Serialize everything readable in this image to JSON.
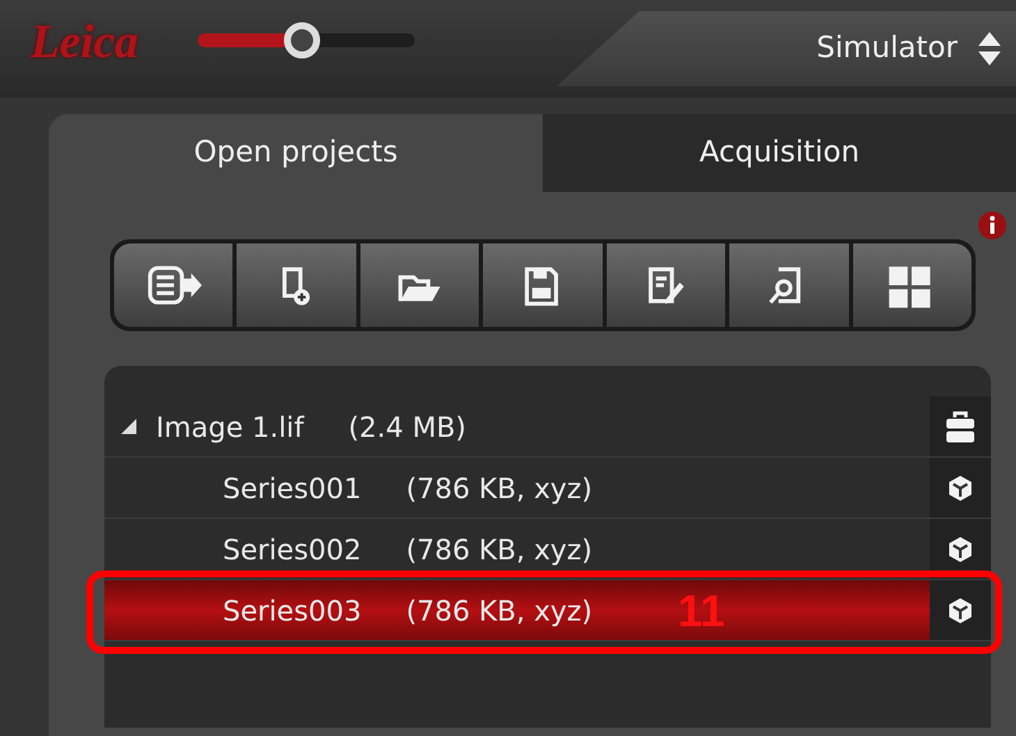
{
  "logo": "Leica",
  "zoom_slider": {
    "level": 0.48
  },
  "dropdown": {
    "value": "Simulator"
  },
  "tabs": [
    {
      "label": "Open projects",
      "selected": true
    },
    {
      "label": "Acquisition",
      "selected": false
    }
  ],
  "tree": {
    "label": "Image 1.lif",
    "size": "(2.4 MB)",
    "expanded": true,
    "children": [
      {
        "label": "Series001",
        "info": "(786 KB, xyz)",
        "selected": false
      },
      {
        "label": "Series002",
        "info": "(786 KB, xyz)",
        "selected": false
      },
      {
        "label": "Series003",
        "info": "(786 KB, xyz)",
        "selected": true
      }
    ]
  },
  "callout": {
    "number": "11"
  }
}
